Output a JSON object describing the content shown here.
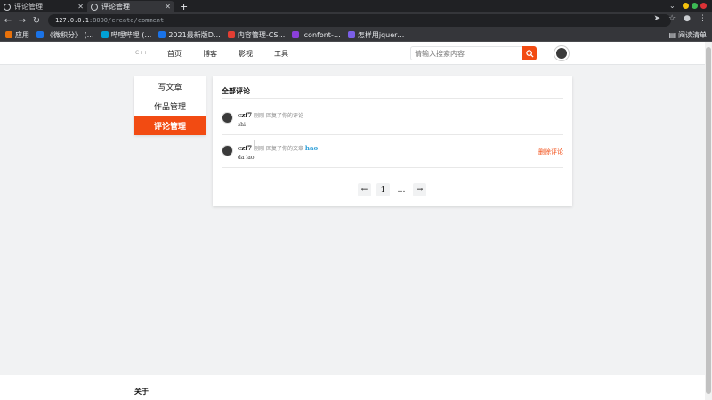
{
  "browser": {
    "tabs": [
      {
        "title": "评论管理",
        "active": false
      },
      {
        "title": "评论管理",
        "active": true
      }
    ],
    "new_tab": "+",
    "url_host": "127.0.0.1",
    "url_path": ":8000/create/comment",
    "bookmarks": [
      {
        "label": "应用",
        "color": "#e8710a"
      },
      {
        "label": "《微积分》 (…",
        "color": "#1a73e8"
      },
      {
        "label": "哔哩哔哩 (…",
        "color": "#00a1d6"
      },
      {
        "label": "2021最新版D…",
        "color": "#1a73e8"
      },
      {
        "label": "内容管理-CS…",
        "color": "#e33e33"
      },
      {
        "label": "iconfont-…",
        "color": "#8b3fd9"
      },
      {
        "label": "怎样用jquer…",
        "color": "#7b5fe8"
      }
    ],
    "reading_list": "阅读清单"
  },
  "header": {
    "logo": "C++",
    "nav": [
      "首页",
      "博客",
      "影视",
      "工具"
    ],
    "search_placeholder": "请输入搜索内容"
  },
  "sidebar": {
    "items": [
      {
        "label": "写文章",
        "active": false
      },
      {
        "label": "作品管理",
        "active": false
      },
      {
        "label": "评论管理",
        "active": true
      }
    ]
  },
  "panel": {
    "title": "全部评论",
    "comments": [
      {
        "user": "czf7",
        "action": "刚刚 回复了你的评论",
        "article": "",
        "text": "shi",
        "delete_label": ""
      },
      {
        "user": "czf7",
        "action": "刚刚 回复了你的文章",
        "article": "hao",
        "text": "da lao",
        "delete_label": "删除评论"
      }
    ],
    "pagination": {
      "prev": "←",
      "page": "1",
      "ellipsis": "…",
      "next": "→"
    }
  },
  "footer": {
    "title": "关于"
  },
  "colors": {
    "accent": "#f24b12",
    "link": "#2e9fd8"
  }
}
